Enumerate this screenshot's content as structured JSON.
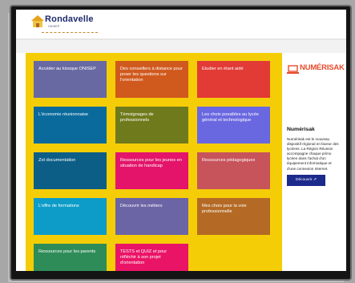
{
  "header": {
    "logo_word": "Rondavelle",
    "logo_sub": "ONISEP",
    "logo_tagline": "LES OUTILS POUR S'ORIENTER"
  },
  "tiles": [
    {
      "label": "Accéder au kiosque ONISEP",
      "color": "#6868a2"
    },
    {
      "label": "Des conseillers à distance pour poser tes questions sur l'orientation",
      "color": "#d0591d"
    },
    {
      "label": "Etudier en étant aidé",
      "color": "#e23a35"
    },
    {
      "label": "L'économie réunionnaise",
      "color": "#0b6a9c"
    },
    {
      "label": "Témoignages de professionnels",
      "color": "#6f7a1c"
    },
    {
      "label": "Les choix possibles au lycée général et technologique",
      "color": "#6a68e0"
    },
    {
      "label": "Zot documentation",
      "color": "#0d5e86"
    },
    {
      "label": "Ressources pour les jeunes en situation de handicap",
      "color": "#e3146a"
    },
    {
      "label": "Ressources pédagogiques",
      "color": "#c7535b"
    },
    {
      "label": "L'offre de formations",
      "color": "#0d9cc8"
    },
    {
      "label": "Découvrir les métiers",
      "color": "#6b64a5"
    },
    {
      "label": "Mes choix pour la voie professionnelle",
      "color": "#b46a25"
    },
    {
      "label": "Ressources pour les parents",
      "color": "#2e8c58"
    },
    {
      "label": "TESTS et QUIZ et pour réfléchir à son projet d'orientation",
      "color": "#ea1466"
    }
  ],
  "side": {
    "logo_text": "NUMÉRISAK",
    "title": "Numérisak",
    "description": "Numérisak est le nouveau dispositif régional en faveur des lycéens. La Région Réunion accompagne chaque primo lycéen dans l'achat d'un équipement informatique et d'une connexion Internet.",
    "button_label": "Découvrir ⇗",
    "accent": "#1c2a8c"
  },
  "colors": {
    "background": "#f4cd07",
    "frame": "#141414"
  }
}
